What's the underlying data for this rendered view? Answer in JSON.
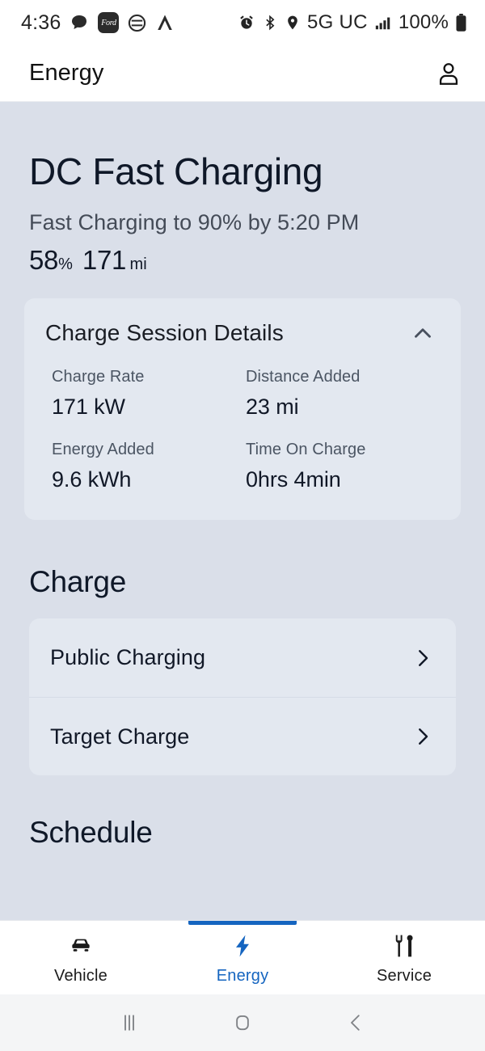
{
  "status_bar": {
    "time": "4:36",
    "left_icons": [
      "message-bubble-icon",
      "ford-app-icon",
      "circle-icon",
      "android-auto-icon"
    ],
    "ford_badge_text": "Ford",
    "network": "5G UC",
    "battery_percent": "100%",
    "right_icons": [
      "alarm-icon",
      "bluetooth-icon",
      "location-icon",
      "signal-bars-icon",
      "battery-icon"
    ]
  },
  "header": {
    "title": "Energy",
    "profile_icon": "person-icon"
  },
  "charging": {
    "title": "DC Fast Charging",
    "status": "Fast Charging to 90% by 5:20 PM",
    "battery_value": "58",
    "battery_unit": "%",
    "range_value": "171",
    "range_unit": "mi"
  },
  "session_card": {
    "title": "Charge Session Details",
    "collapse_icon": "chevron-up-icon",
    "metrics": [
      {
        "label": "Charge Rate",
        "value": "171 kW"
      },
      {
        "label": "Distance Added",
        "value": "23 mi"
      },
      {
        "label": "Energy Added",
        "value": "9.6 kWh"
      },
      {
        "label": "Time On Charge",
        "value": "0hrs 4min"
      }
    ]
  },
  "charge_section": {
    "heading": "Charge",
    "rows": [
      {
        "label": "Public Charging",
        "chevron": "chevron-right-icon"
      },
      {
        "label": "Target Charge",
        "chevron": "chevron-right-icon"
      }
    ]
  },
  "schedule_section": {
    "heading": "Schedule"
  },
  "bottom_nav": {
    "items": [
      {
        "label": "Vehicle",
        "icon": "car-icon",
        "active": false
      },
      {
        "label": "Energy",
        "icon": "lightning-bolt-icon",
        "active": true
      },
      {
        "label": "Service",
        "icon": "wrench-screwdriver-icon",
        "active": false
      }
    ],
    "accent_color": "#1565c0"
  },
  "system_nav": {
    "recents_icon": "recents-icon",
    "home_icon": "home-icon",
    "back_icon": "back-icon"
  }
}
